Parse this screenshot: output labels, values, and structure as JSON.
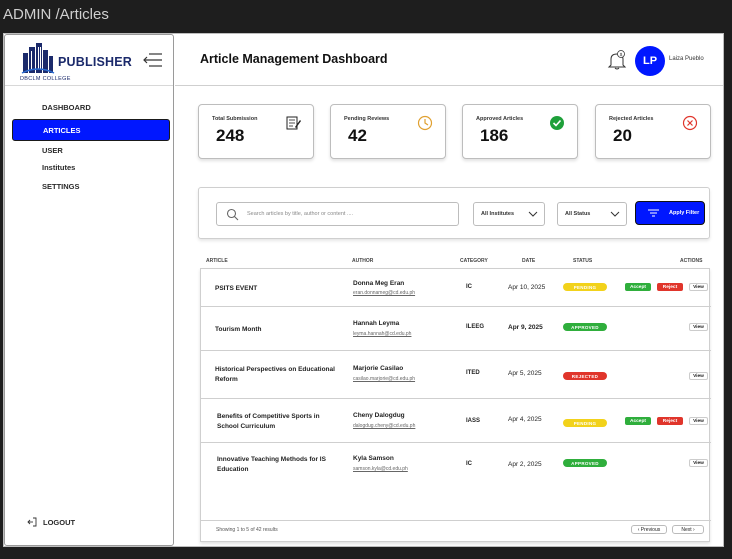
{
  "frame": {
    "title": "ADMIN /Articles"
  },
  "brand": {
    "name": "PUBLISHER",
    "sub": "DBCLM COLLEGE"
  },
  "nav": {
    "items": [
      {
        "label": "DASHBOARD"
      },
      {
        "label": "ARTICLES"
      },
      {
        "label": "USER"
      },
      {
        "label": "Institutes"
      },
      {
        "label": "SETTINGS"
      }
    ],
    "logout": "LOGOUT"
  },
  "header": {
    "title": "Article Management Dashboard",
    "avatar_initials": "LP",
    "user_name": "Laiza Pueblo"
  },
  "stats": [
    {
      "label": "Total Submission",
      "value": "248",
      "icon": "document-edit-icon"
    },
    {
      "label": "Pending Reviews",
      "value": "42",
      "icon": "clock-icon"
    },
    {
      "label": "Approved Articles",
      "value": "186",
      "icon": "check-circle-icon"
    },
    {
      "label": "Rejected Articles",
      "value": "20",
      "icon": "x-circle-icon"
    }
  ],
  "filters": {
    "search_placeholder": "Search articles by title, author or content ....",
    "institute": "All Institutes",
    "status": "All Status",
    "apply_label": "Apply Filter"
  },
  "table": {
    "headers": {
      "article": "ARTICLE",
      "author": "AUTHOR",
      "category": "CATEGORY",
      "date": "DATE",
      "status": "STATUS",
      "actions": "ACTIONS"
    },
    "rows": [
      {
        "title": "PSITS EVENT",
        "author": "Donna Meg Eran",
        "email": "eran.donnameg@cd.edu.ph",
        "category": "IC",
        "date": "Apr 10, 2025",
        "status": "PENDING",
        "accept": "Accept",
        "reject": "Reject",
        "view": "View"
      },
      {
        "title": "Tourism Month",
        "author": "Hannah Leyma",
        "email": "leyma.hannah@cd.edu.ph",
        "category": "ILEEG",
        "date": "Apr 9, 2025",
        "status": "APPROVED",
        "view": "View"
      },
      {
        "title": "Historical Perspectives on Educational Reform",
        "author": "Marjorie Casilao",
        "email": "casilao.marjorie@cd.edu.ph",
        "category": "ITED",
        "date": "Apr 5, 2025",
        "status": "REJECTED",
        "view": "View"
      },
      {
        "title": "Benefits of Competitive Sports in School Curriculum",
        "author": "Cheny Dalogdug",
        "email": "dalogdug.cheny@cd.edu.ph",
        "category": "IASS",
        "date": "Apr 4, 2025",
        "status": "PENDING",
        "accept": "Accept",
        "reject": "Reject",
        "view": "View"
      },
      {
        "title": "Innovative Teaching Methods for IS Education",
        "author": "Kyla Samson",
        "email": "samson.kyla@cd.edu.ph",
        "category": "IC",
        "date": "Apr 2, 2025",
        "status": "APPROVED",
        "view": "View"
      }
    ],
    "footer": {
      "info": "Showing 1 to 5 of 42 results",
      "prev": "‹ Previous",
      "next": "Next ›"
    }
  },
  "colors": {
    "accent": "#0017ff",
    "pending": "#f2d21b",
    "approved": "#2fae3c",
    "rejected": "#e0352b",
    "brand": "#1b2a6b"
  }
}
